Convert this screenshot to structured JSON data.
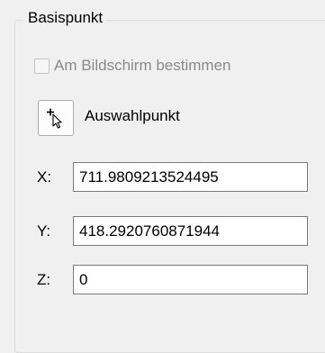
{
  "group": {
    "title": "Basispunkt"
  },
  "screen_checkbox": {
    "label": "Am Bildschirm bestimmen",
    "checked": false,
    "enabled": false
  },
  "pick_button": {
    "icon": "pick-point-cursor-icon",
    "label": "Auswahlpunkt"
  },
  "coordinates": {
    "x": {
      "label": "X:",
      "value": "711.9809213524495"
    },
    "y": {
      "label": "Y:",
      "value": "418.2920760871944"
    },
    "z": {
      "label": "Z:",
      "value": "0"
    }
  }
}
